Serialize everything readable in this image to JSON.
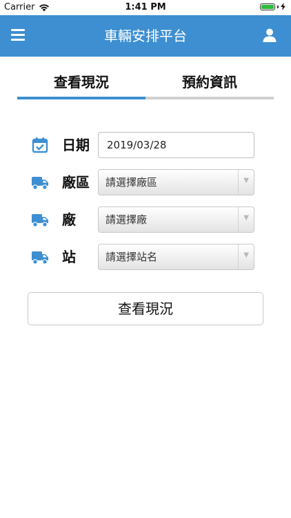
{
  "status_bar": {
    "carrier": "Carrier",
    "time": "1:41 PM"
  },
  "nav": {
    "title": "車輛安排平台",
    "menu_icon": "hamburger-menu-icon",
    "user_icon": "user-icon"
  },
  "tabs": [
    {
      "label": "查看現況",
      "active": true
    },
    {
      "label": "預約資訊",
      "active": false
    }
  ],
  "form": {
    "date": {
      "label": "日期",
      "value": "2019/03/28",
      "icon": "calendar-check-icon"
    },
    "area": {
      "label": "廠區",
      "placeholder": "請選擇廠區",
      "icon": "truck-icon"
    },
    "factory": {
      "label": "廠",
      "placeholder": "請選擇廠",
      "icon": "truck-icon"
    },
    "station": {
      "label": "站",
      "placeholder": "請選擇站名",
      "icon": "truck-icon"
    }
  },
  "submit_label": "查看現況",
  "colors": {
    "primary": "#3d8fd1",
    "inactive_tab_line": "#cfcfcf"
  }
}
